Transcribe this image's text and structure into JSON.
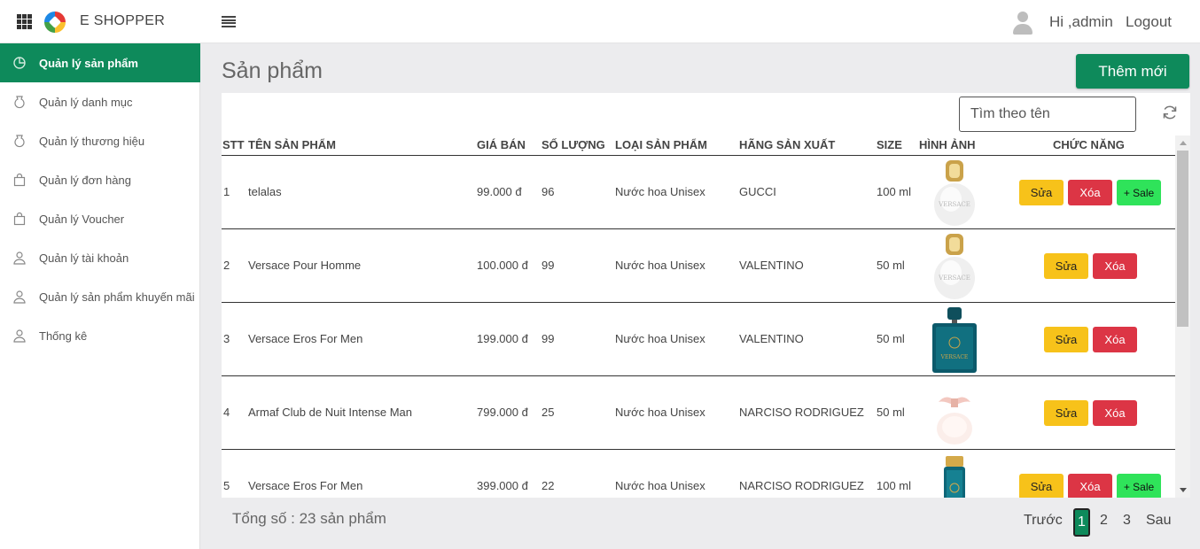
{
  "header": {
    "brand": "E SHOPPER",
    "greeting": "Hi ,admin",
    "logout_label": "Logout"
  },
  "sidebar": {
    "items": [
      {
        "label": "Quản lý sản phẩm",
        "icon": "pie-chart-icon",
        "active": true
      },
      {
        "label": "Quản lý danh mục",
        "icon": "bag-icon"
      },
      {
        "label": "Quản lý thương hiệu",
        "icon": "bag-icon"
      },
      {
        "label": "Quản lý đơn hàng",
        "icon": "shopping-bag-icon"
      },
      {
        "label": "Quản lý Voucher",
        "icon": "shopping-bag-icon"
      },
      {
        "label": "Quản lý tài khoản",
        "icon": "user-icon"
      },
      {
        "label": "Quản lý sản phẩm khuyến mãi",
        "icon": "user-icon"
      },
      {
        "label": "Thống kê",
        "icon": "user-icon"
      }
    ]
  },
  "page": {
    "title": "Sản phẩm",
    "add_button": "Thêm mới",
    "search_placeholder": "Tìm theo tên",
    "total": "Tổng số : 23 sản phẩm"
  },
  "table": {
    "headers": [
      "STT",
      "TÊN SẢN PHẨM",
      "GIÁ BÁN",
      "SỐ LƯỢNG",
      "LOẠI SẢN PHẨM",
      "HÃNG SẢN XUẤT",
      "SIZE",
      "HÌNH ẢNH",
      "CHỨC NĂNG"
    ],
    "rows": [
      {
        "stt": "1",
        "name": "telalas",
        "price": "99.000 đ",
        "qty": "96",
        "type": "Nước hoa Unisex",
        "brand": "GUCCI",
        "size": "100 ml",
        "image": "white-bottle",
        "sale": true
      },
      {
        "stt": "2",
        "name": "Versace Pour Homme",
        "price": "100.000 đ",
        "qty": "99",
        "type": "Nước hoa Unisex",
        "brand": "VALENTINO",
        "size": "50 ml",
        "image": "white-bottle",
        "sale": false
      },
      {
        "stt": "3",
        "name": "Versace Eros For Men",
        "price": "199.000 đ",
        "qty": "99",
        "type": "Nước hoa Unisex",
        "brand": "VALENTINO",
        "size": "50 ml",
        "image": "blue-bottle",
        "sale": false
      },
      {
        "stt": "4",
        "name": "Armaf Club de Nuit Intense Man",
        "price": "799.000 đ",
        "qty": "25",
        "type": "Nước hoa Unisex",
        "brand": "NARCISO RODRIGUEZ",
        "size": "50 ml",
        "image": "pink-bottle",
        "sale": false
      },
      {
        "stt": "5",
        "name": "Versace Eros For Men",
        "price": "399.000 đ",
        "qty": "22",
        "type": "Nước hoa Unisex",
        "brand": "NARCISO RODRIGUEZ",
        "size": "100 ml",
        "image": "tall-blue-bottle",
        "sale": true
      }
    ],
    "edit_label": "Sửa",
    "delete_label": "Xóa",
    "sale_label": "+ Sale"
  },
  "pagination": {
    "prev": "Trước",
    "pages": [
      "1",
      "2",
      "3"
    ],
    "current": "1",
    "next": "Sau"
  },
  "colors": {
    "primary": "#0e8a5b",
    "edit": "#f7c21a",
    "delete": "#dc3545",
    "sale": "#2fe35a"
  }
}
